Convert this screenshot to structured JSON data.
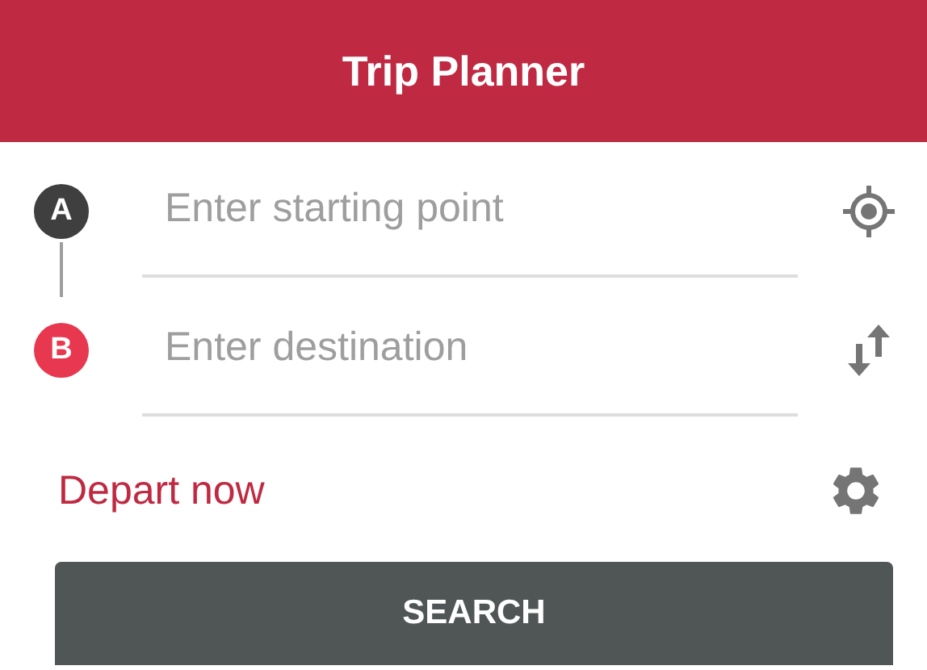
{
  "header": {
    "title": "Trip Planner"
  },
  "fields": [
    {
      "marker": "A",
      "color": "#3f3f3f",
      "placeholder": "Enter starting point",
      "kind": "locate"
    },
    {
      "marker": "B",
      "color": "#e8384f",
      "placeholder": "Enter destination",
      "kind": "swap"
    }
  ],
  "options": {
    "label": "Depart now"
  },
  "button": {
    "label": "SEARCH"
  }
}
